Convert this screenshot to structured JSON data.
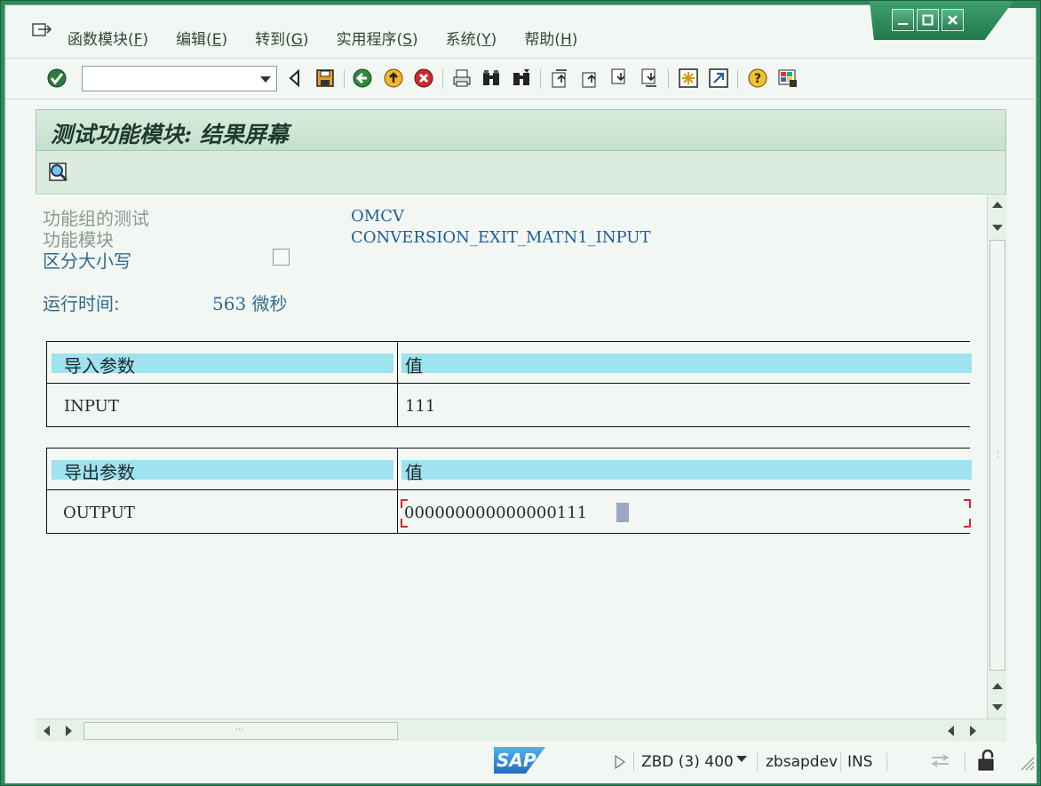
{
  "menubar": {
    "items": [
      {
        "text": "函数模块(",
        "key": "F",
        "end": ")"
      },
      {
        "text": "编辑(",
        "key": "E",
        "end": ")"
      },
      {
        "text": "转到(",
        "key": "G",
        "end": ")"
      },
      {
        "text": "实用程序(",
        "key": "S",
        "end": ")"
      },
      {
        "text": "系统(",
        "key": "Y",
        "end": ")"
      },
      {
        "text": "帮助(",
        "key": "H",
        "end": ")"
      }
    ]
  },
  "toolbar": {
    "command_field_value": ""
  },
  "screen": {
    "title": "测试功能模块: 结果屏幕"
  },
  "header_fields": {
    "function_group_label": "功能组的测试",
    "function_group_value": "OMCV",
    "function_module_label": "功能模块",
    "function_module_value": "CONVERSION_EXIT_MATN1_INPUT",
    "case_sensitive_label": "区分大小写",
    "runtime_label": "运行时间:",
    "runtime_value": "563 微秒"
  },
  "import_table": {
    "col1_header": "导入参数",
    "col2_header": "值",
    "param_name": "INPUT",
    "param_value": "111"
  },
  "export_table": {
    "col1_header": "导出参数",
    "col2_header": "值",
    "param_name": "OUTPUT",
    "param_value": "000000000000000111"
  },
  "statusbar": {
    "logo_text": "SAP",
    "system": "ZBD (3) 400",
    "server": "zbsapdev",
    "mode": "INS"
  },
  "colors": {
    "frame_green": "#2e8a5c",
    "title_bg": "#c4e0cc",
    "table_header_bg": "#9fe2f0",
    "value_blue": "#1d5d9b"
  }
}
